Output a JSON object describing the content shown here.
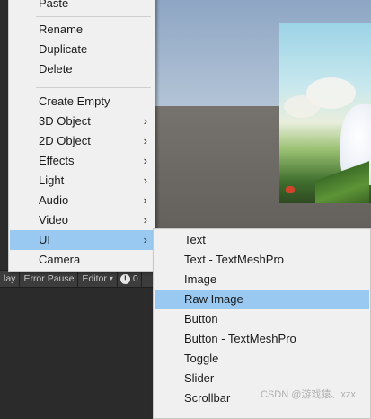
{
  "main_menu": {
    "items": [
      {
        "label": "Paste",
        "submenu": false
      },
      {
        "label": "Rename",
        "submenu": false
      },
      {
        "label": "Duplicate",
        "submenu": false
      },
      {
        "label": "Delete",
        "submenu": false
      },
      {
        "label": "Create Empty",
        "submenu": false
      },
      {
        "label": "3D Object",
        "submenu": true
      },
      {
        "label": "2D Object",
        "submenu": true
      },
      {
        "label": "Effects",
        "submenu": true
      },
      {
        "label": "Light",
        "submenu": true
      },
      {
        "label": "Audio",
        "submenu": true
      },
      {
        "label": "Video",
        "submenu": true
      },
      {
        "label": "UI",
        "submenu": true,
        "highlighted": true
      },
      {
        "label": "Camera",
        "submenu": false
      }
    ],
    "arrow_glyph": "›"
  },
  "ui_submenu": {
    "items": [
      {
        "label": "Text"
      },
      {
        "label": "Text - TextMeshPro"
      },
      {
        "label": "Image"
      },
      {
        "label": "Raw Image",
        "highlighted": true
      },
      {
        "label": "Button"
      },
      {
        "label": "Button - TextMeshPro"
      },
      {
        "label": "Toggle"
      },
      {
        "label": "Slider"
      },
      {
        "label": "Scrollbar"
      }
    ]
  },
  "toolbar": {
    "play_label": "lay",
    "error_pause_label": "Error Pause",
    "editor_label": "Editor",
    "editor_caret": "▾",
    "info_glyph": "!",
    "info_count": "0"
  },
  "watermark": "CSDN @游戏猿、xzx",
  "colors": {
    "menu_bg": "#f0f0f0",
    "highlight": "#99c9f0",
    "editor_dark": "#2b2b2b"
  }
}
